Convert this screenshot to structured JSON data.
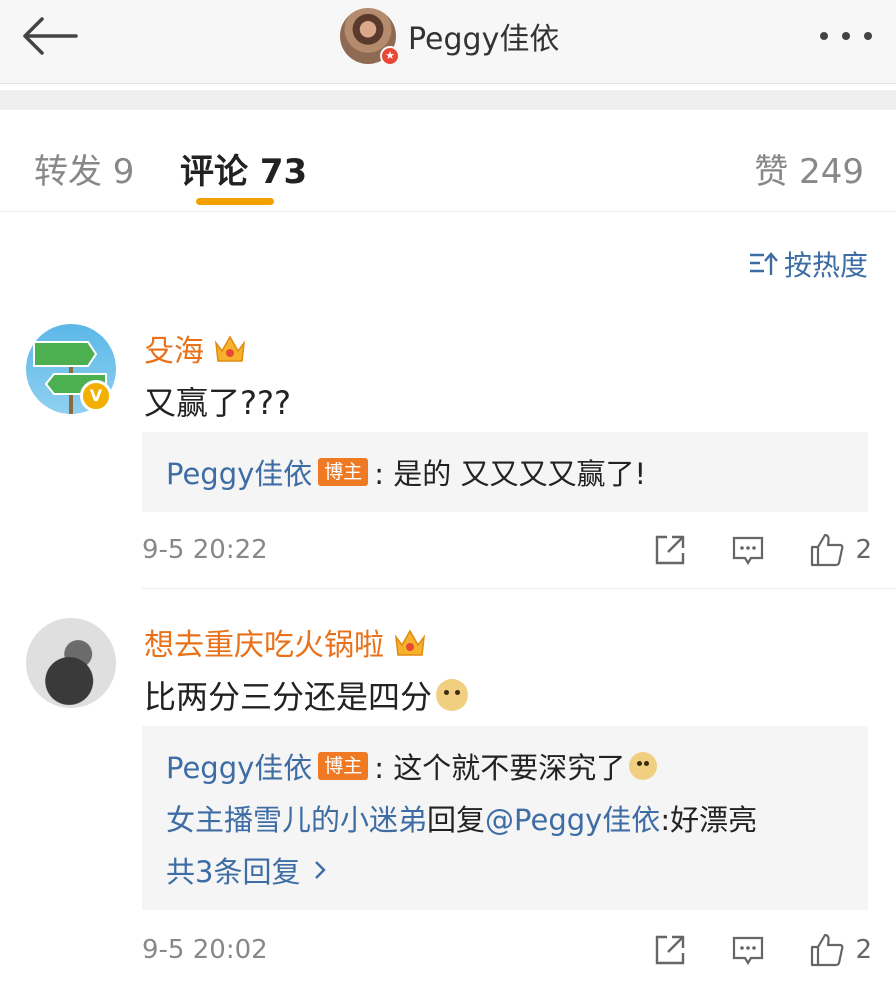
{
  "header": {
    "title": "Peggy佳依"
  },
  "tabs": [
    {
      "label": "转发 9"
    },
    {
      "label": "评论 73"
    },
    {
      "label": "赞 249"
    }
  ],
  "sort_label": "按热度",
  "comments": [
    {
      "username": "殳海",
      "text": "又赢了???",
      "replies": [
        {
          "author": "Peggy佳依",
          "tag": "博主",
          "text": ": 是的 又又又又赢了!"
        }
      ],
      "time": "9-5 20:22",
      "likes": "2"
    },
    {
      "username": "想去重庆吃火锅啦",
      "text": "比两分三分还是四分",
      "replies": [
        {
          "author": "Peggy佳依",
          "tag": "博主",
          "text": ": 这个就不要深究了"
        },
        {
          "author": "女主播雪儿的小迷弟",
          "mid": "回复",
          "mention": "@Peggy佳依",
          "text": ":好漂亮"
        }
      ],
      "more_replies": "共3条回复",
      "time": "9-5 20:02",
      "likes": "2"
    }
  ],
  "colors": {
    "username": "#e8711a",
    "link": "#3d6da4",
    "tab_indicator": "#f2a000",
    "blogger_tag": "#f07a24"
  },
  "icons": [
    "back-arrow-icon",
    "more-dots-icon",
    "sort-icon",
    "crown-icon",
    "verified-icon",
    "repost-icon",
    "comment-icon",
    "like-icon",
    "chevron-right-icon",
    "doge-emoji-icon"
  ]
}
